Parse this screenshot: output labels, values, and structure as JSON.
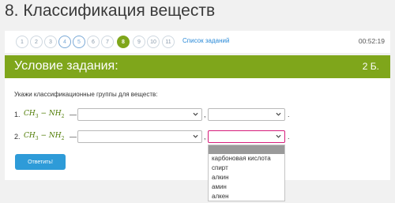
{
  "page_title": "8. Классификация веществ",
  "nav": {
    "items": [
      "1",
      "2",
      "3",
      "4",
      "5",
      "6",
      "7",
      "8",
      "9",
      "10",
      "11"
    ],
    "current": "8",
    "task_list_link": "Список заданий",
    "timer": "00:52:19"
  },
  "card": {
    "title": "Условие задания:",
    "points": "2 Б.",
    "instruction": "Укажи классификационные группы для веществ:",
    "rows": [
      {
        "num": "1.",
        "formula_a": "CH",
        "sub_a": "3",
        "formula_mid": " − NH",
        "sub_b": "2",
        "dash": "—",
        "sep": ",",
        "end": "."
      },
      {
        "num": "2.",
        "formula_a": "CH",
        "sub_a": "3",
        "formula_mid": " − NH",
        "sub_b": "2",
        "dash": "—",
        "sep": ",",
        "end": "."
      }
    ],
    "answer_button": "Ответить!"
  },
  "dropdown": {
    "options": [
      "карбоновая кислота",
      "спирт",
      "алкин",
      "амин",
      "алкен"
    ]
  },
  "colors": {
    "accent_green": "#7fa61b",
    "link_blue": "#2a8ad8",
    "button_blue": "#2e9bd8",
    "focus_pink": "#d61c7a"
  }
}
